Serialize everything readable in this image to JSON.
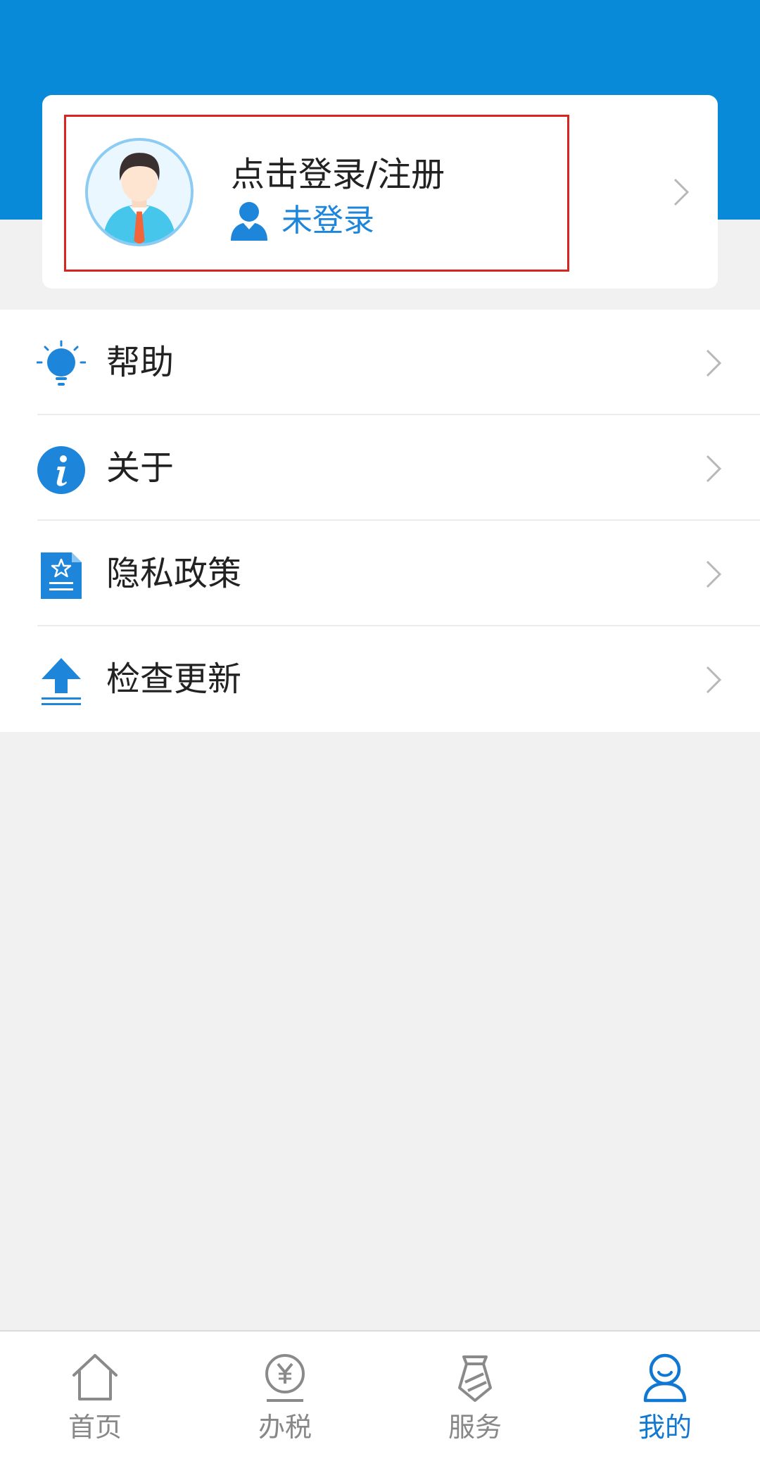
{
  "profile": {
    "login_title": "点击登录/注册",
    "status_text": "未登录"
  },
  "menu": {
    "items": [
      {
        "label": "帮助",
        "icon": "lightbulb-icon"
      },
      {
        "label": "关于",
        "icon": "info-icon"
      },
      {
        "label": "隐私政策",
        "icon": "document-star-icon"
      },
      {
        "label": "检查更新",
        "icon": "upload-icon"
      }
    ]
  },
  "tabbar": {
    "items": [
      {
        "label": "首页",
        "icon": "home-icon",
        "active": false
      },
      {
        "label": "办税",
        "icon": "yen-coin-icon",
        "active": false
      },
      {
        "label": "服务",
        "icon": "tie-icon",
        "active": false
      },
      {
        "label": "我的",
        "icon": "person-icon",
        "active": true
      }
    ]
  },
  "colors": {
    "header_blue": "#088ad9",
    "accent_blue": "#1d86db",
    "active_tab": "#1078d3",
    "inactive_tab": "#888888",
    "highlight_border": "#d8251f",
    "page_background": "#f1f1f1"
  }
}
